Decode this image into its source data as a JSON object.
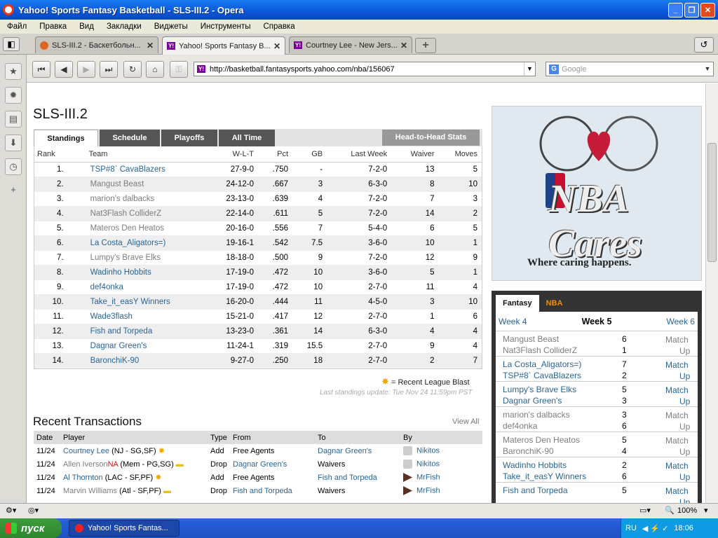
{
  "window": {
    "title": "Yahoo! Sports Fantasy Basketball - SLS-III.2 - Opera"
  },
  "menu": [
    "Файл",
    "Правка",
    "Вид",
    "Закладки",
    "Виджеты",
    "Инструменты",
    "Справка"
  ],
  "tabs": [
    {
      "label": "SLS-III.2 - Баскетбольн...",
      "active": false
    },
    {
      "label": "Yahoo! Sports Fantasy B...",
      "active": true
    },
    {
      "label": "Courtney Lee - New Jers...",
      "active": false
    }
  ],
  "address": {
    "url": "http://basketball.fantasysports.yahoo.com/nba/156067"
  },
  "search": {
    "placeholder": "Google"
  },
  "page": {
    "league_title": "SLS-III.2",
    "tabs": [
      "Standings",
      "Schedule",
      "Playoffs",
      "All Time"
    ],
    "h2h_label": "Head-to-Head Stats",
    "standings_headers": [
      "Rank",
      "Team",
      "W-L-T",
      "Pct",
      "GB",
      "Last Week",
      "Waiver",
      "Moves"
    ],
    "standings": [
      {
        "rank": "1.",
        "team": "TSP#8` CavaBlazers",
        "wlt": "27-9-0",
        "pct": ".750",
        "gb": "-",
        "last": "7-2-0",
        "waiver": "13",
        "moves": "5",
        "gray": false
      },
      {
        "rank": "2.",
        "team": "Mangust Beast",
        "wlt": "24-12-0",
        "pct": ".667",
        "gb": "3",
        "last": "6-3-0",
        "waiver": "8",
        "moves": "10",
        "gray": true
      },
      {
        "rank": "3.",
        "team": "marion's dalbacks",
        "wlt": "23-13-0",
        "pct": ".639",
        "gb": "4",
        "last": "7-2-0",
        "waiver": "7",
        "moves": "3",
        "gray": true
      },
      {
        "rank": "4.",
        "team": "Nat3Flash ColliderZ",
        "wlt": "22-14-0",
        "pct": ".611",
        "gb": "5",
        "last": "7-2-0",
        "waiver": "14",
        "moves": "2",
        "gray": true
      },
      {
        "rank": "5.",
        "team": "Materos Den Heatos",
        "wlt": "20-16-0",
        "pct": ".556",
        "gb": "7",
        "last": "5-4-0",
        "waiver": "6",
        "moves": "5",
        "gray": true
      },
      {
        "rank": "6.",
        "team": "La Costa_Aligators=)",
        "wlt": "19-16-1",
        "pct": ".542",
        "gb": "7.5",
        "last": "3-6-0",
        "waiver": "10",
        "moves": "1",
        "gray": false
      },
      {
        "rank": "7.",
        "team": "Lumpy's Brave Elks",
        "wlt": "18-18-0",
        "pct": ".500",
        "gb": "9",
        "last": "7-2-0",
        "waiver": "12",
        "moves": "9",
        "gray": true
      },
      {
        "rank": "8.",
        "team": "Wadinho Hobbits",
        "wlt": "17-19-0",
        "pct": ".472",
        "gb": "10",
        "last": "3-6-0",
        "waiver": "5",
        "moves": "1",
        "gray": false
      },
      {
        "rank": "9.",
        "team": "def4onka",
        "wlt": "17-19-0",
        "pct": ".472",
        "gb": "10",
        "last": "2-7-0",
        "waiver": "11",
        "moves": "4",
        "gray": false
      },
      {
        "rank": "10.",
        "team": "Take_it_easY Winners",
        "wlt": "16-20-0",
        "pct": ".444",
        "gb": "11",
        "last": "4-5-0",
        "waiver": "3",
        "moves": "10",
        "gray": false
      },
      {
        "rank": "11.",
        "team": "Wade3flash",
        "wlt": "15-21-0",
        "pct": ".417",
        "gb": "12",
        "last": "2-7-0",
        "waiver": "1",
        "moves": "6",
        "gray": false
      },
      {
        "rank": "12.",
        "team": "Fish and Torpeda",
        "wlt": "13-23-0",
        "pct": ".361",
        "gb": "14",
        "last": "6-3-0",
        "waiver": "4",
        "moves": "4",
        "gray": false
      },
      {
        "rank": "13.",
        "team": "Dagnar Green's",
        "wlt": "11-24-1",
        "pct": ".319",
        "gb": "15.5",
        "last": "2-7-0",
        "waiver": "9",
        "moves": "4",
        "gray": false
      },
      {
        "rank": "14.",
        "team": "BaronchiK-90",
        "wlt": "9-27-0",
        "pct": ".250",
        "gb": "18",
        "last": "2-7-0",
        "waiver": "2",
        "moves": "7",
        "gray": false
      }
    ],
    "legend": "= Recent League Blast",
    "last_update": "Last standings update: Tue Nov 24 11:59pm PST",
    "rt_title": "Recent Transactions",
    "view_all": "View All",
    "trans_headers": [
      "Date",
      "Player",
      "Type",
      "From",
      "To",
      "By"
    ],
    "transactions": [
      {
        "date": "11/24",
        "player": "Courtney Lee",
        "team": "(NJ - SG,SF)",
        "type": "Add",
        "from": "Free Agents",
        "to": "Dagnar Green's",
        "by": "Nikitos"
      },
      {
        "date": "11/24",
        "player": "Allen Iverson",
        "na": "NA",
        "team": "(Mem - PG,SG)",
        "type": "Drop",
        "from": "Dagnar Green's",
        "to": "Waivers",
        "by": "Nikitos"
      },
      {
        "date": "11/24",
        "player": "Al Thornton",
        "team": "(LAC - SF,PF)",
        "type": "Add",
        "from": "Free Agents",
        "to": "Fish and Torpeda",
        "by": "MrFish"
      },
      {
        "date": "11/24",
        "player": "Marvin Williams",
        "team": "(Atl - SF,PF)",
        "type": "Drop",
        "from": "Fish and Torpeda",
        "to": "Waivers",
        "by": "MrFish"
      }
    ],
    "ad": {
      "logo_text": "NBA Cares",
      "tagline": "Where caring happens."
    },
    "matchups": {
      "tabs": [
        "Fantasy",
        "NBA"
      ],
      "prev_week": "Week 4",
      "cur_week": "Week 5",
      "next_week": "Week 6",
      "match": "Match",
      "up": "Up",
      "rows": [
        {
          "t1": "Mangust Beast",
          "s1": "6",
          "t2": "Nat3Flash ColliderZ",
          "s2": "1",
          "gray": true
        },
        {
          "t1": "La Costa_Aligators=)",
          "s1": "7",
          "t2": "TSP#8` CavaBlazers",
          "s2": "2",
          "gray": false
        },
        {
          "t1": "Lumpy's Brave Elks",
          "s1": "5",
          "t2": "Dagnar Green's",
          "s2": "3",
          "gray": false
        },
        {
          "t1": "marion's dalbacks",
          "s1": "3",
          "t2": "def4onka",
          "s2": "6",
          "gray": true
        },
        {
          "t1": "Materos Den Heatos",
          "s1": "5",
          "t2": "BaronchiK-90",
          "s2": "4",
          "gray": true
        },
        {
          "t1": "Wadinho Hobbits",
          "s1": "2",
          "t2": "Take_it_easY Winners",
          "s2": "6",
          "gray": false
        },
        {
          "t1": "Fish and Torpeda",
          "s1": "5",
          "t2": "",
          "s2": "",
          "gray": false
        }
      ]
    }
  },
  "status": {
    "zoom": "100%"
  },
  "taskbar": {
    "start": "пуск",
    "item": "Yahoo! Sports Fantas...",
    "lang": "RU",
    "time": "18:06"
  }
}
